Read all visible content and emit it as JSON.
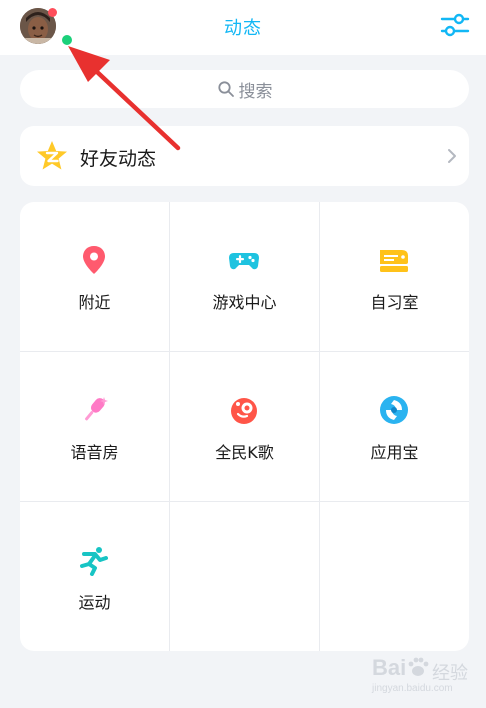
{
  "header": {
    "title": "动态",
    "avatar_icon": "user-avatar",
    "filter_icon": "sliders-icon"
  },
  "search": {
    "placeholder": "搜索",
    "icon": "search-icon"
  },
  "friend_feed": {
    "label": "好友动态",
    "icon": "qzone-star-icon"
  },
  "grid": {
    "items": [
      {
        "label": "附近",
        "icon": "location-pin-icon",
        "color": "#ff5a6e"
      },
      {
        "label": "游戏中心",
        "icon": "gamepad-icon",
        "color": "#1ec3e0"
      },
      {
        "label": "自习室",
        "icon": "study-room-icon",
        "color": "#ffc21a"
      },
      {
        "label": "语音房",
        "icon": "microphone-icon",
        "color": "#ff7ac6"
      },
      {
        "label": "全民K歌",
        "icon": "karaoke-icon",
        "color": "#ff5548"
      },
      {
        "label": "应用宝",
        "icon": "app-store-icon",
        "color": "#2ab3f0"
      },
      {
        "label": "运动",
        "icon": "running-icon",
        "color": "#17c4c4"
      }
    ]
  },
  "colors": {
    "accent": "#12b7f5",
    "background": "#f2f4f7",
    "annotation_arrow": "#e8312f"
  },
  "watermark": {
    "brand": "Bai",
    "text": "经验",
    "url": "jingyan.baidu.com"
  }
}
